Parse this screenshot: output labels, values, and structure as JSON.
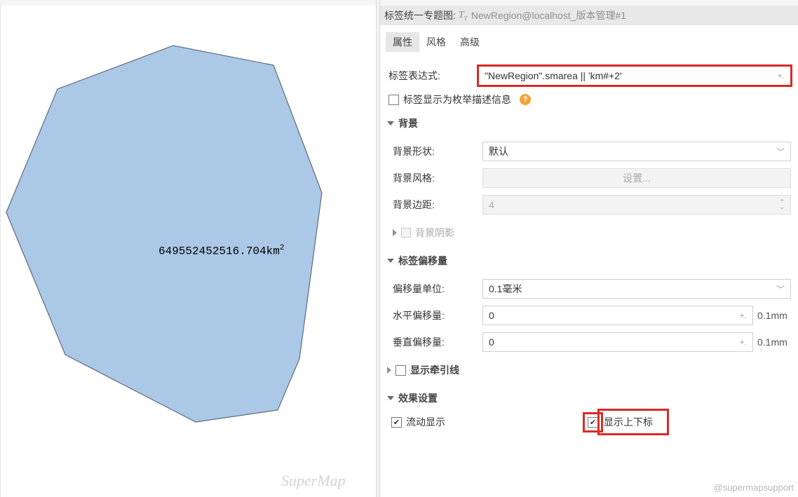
{
  "header": {
    "title": "标签统一专题图:",
    "layer_name": "NewRegion@localhost_版本管理#1"
  },
  "tabs": {
    "items": [
      {
        "label": "属性",
        "active": true
      },
      {
        "label": "风格",
        "active": false
      },
      {
        "label": "高级",
        "active": false
      }
    ]
  },
  "expr": {
    "label": "标签表达式:",
    "value": "\"NewRegion\".smarea || 'km#+2'"
  },
  "enum_display": {
    "label": "标签显示为枚举描述信息",
    "checked": false
  },
  "section_bg": {
    "title": "背景",
    "shape": {
      "label": "背景形状:",
      "value": "默认"
    },
    "style": {
      "label": "背景风格:",
      "button": "设置..."
    },
    "margin": {
      "label": "背景边距:",
      "value": "4"
    },
    "shadow": {
      "title": "背景阴影"
    }
  },
  "section_offset": {
    "title": "标签偏移量",
    "unit": {
      "label": "偏移量单位:",
      "value": "0.1毫米"
    },
    "h": {
      "label": "水平偏移量:",
      "value": "0",
      "unit": "0.1mm"
    },
    "v": {
      "label": "垂直偏移量:",
      "value": "0",
      "unit": "0.1mm"
    }
  },
  "section_leader": {
    "title": "显示牵引线",
    "checked": false
  },
  "section_effects": {
    "title": "效果设置",
    "flow": {
      "label": "流动显示",
      "checked": true
    },
    "supersub": {
      "label": "显示上下标",
      "checked": true
    }
  },
  "canvas": {
    "label_number": "649552452516.704",
    "label_unit": "km",
    "label_exp": "2"
  },
  "watermarks": {
    "brand": "SuperMap",
    "support": "@supermapsupport"
  }
}
